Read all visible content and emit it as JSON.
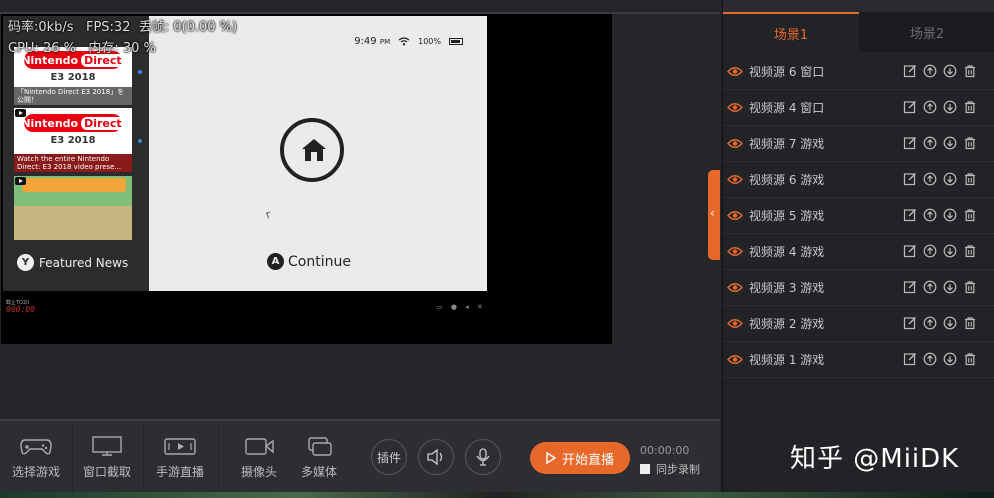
{
  "stats": {
    "line1": "码率:0kb/s   FPS:32  丢帧: 0(0.00 %)",
    "line2": "CPU: 26 %   内存: 30 %"
  },
  "switch_screen": {
    "time": "9:49",
    "time_suffix": "PM",
    "battery": "100%",
    "continue_button": "A",
    "continue_label": "Continue",
    "featured_button": "Y",
    "featured_label": "Featured News",
    "thumbs": [
      {
        "logo_left": "Nintendo",
        "logo_right": "Direct",
        "event": "E3 2018",
        "caption": "「Nintendo Direct E3 2018」を公開！"
      },
      {
        "logo_left": "Nintendo",
        "logo_right": "Direct",
        "event": "E3 2018",
        "caption": "Watch the entire Nintendo Direct: E3 2018 video prese..."
      },
      {
        "caption": ""
      }
    ],
    "counter": "000:00",
    "strip_label": "截止TO2II",
    "strip_icons": "▭ ● ◂ ✕"
  },
  "scene_tabs": [
    {
      "label": "场景1",
      "active": true
    },
    {
      "label": "场景2",
      "active": false
    }
  ],
  "sources": [
    {
      "label": "视频源 6 窗口"
    },
    {
      "label": "视频源 4 窗口"
    },
    {
      "label": "视频源 7 游戏"
    },
    {
      "label": "视频源 6 游戏"
    },
    {
      "label": "视频源 5 游戏"
    },
    {
      "label": "视频源 4 游戏"
    },
    {
      "label": "视频源 3 游戏"
    },
    {
      "label": "视频源 2 游戏"
    },
    {
      "label": "视频源 1 游戏"
    }
  ],
  "toolbar": {
    "select_game": "选择游戏",
    "window_capture": "窗口截取",
    "mobile_live": "手游直播",
    "camera": "摄像头",
    "multimedia": "多媒体",
    "plugins": "插件",
    "start_live": "开始直播",
    "timer": "00:00:00",
    "sync_record": "同步录制"
  },
  "watermark": "知乎 @MiiDK",
  "colors": {
    "accent": "#e8682a"
  }
}
